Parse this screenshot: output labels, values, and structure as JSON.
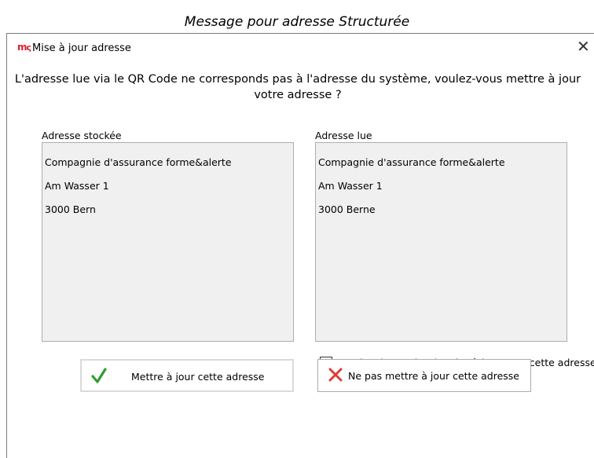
{
  "caption": "Message pour adresse Structurée",
  "dialog": {
    "app_icon": "m",
    "title": "Mise à jour adresse",
    "close_symbol": "✕",
    "message_line1": "L'adresse lue via le QR Code ne corresponds pas à l'adresse du système, voulez-vous mettre à jour",
    "message_line2": "votre adresse ?",
    "stored": {
      "label": "Adresse stockée",
      "lines": [
        "Compagnie d'assurance forme&alerte",
        "Am Wasser 1",
        "3000 Bern"
      ]
    },
    "read": {
      "label": "Adresse lue",
      "lines": [
        "Compagnie d'assurance forme&alerte",
        "Am Wasser 1",
        "3000 Berne"
      ]
    },
    "checkbox": {
      "label": "Ne plus demander de mise à jour pour cette adresse",
      "checked": false
    },
    "buttons": {
      "update_label": "Mettre à jour cette adresse",
      "update_icon": "checkmark-icon",
      "skip_label": "Ne pas mettre à jour cette adresse",
      "skip_icon": "red-x-icon"
    },
    "colors": {
      "brand": "#d8202f",
      "check": "#2e9e2e",
      "cross": "#e03c31"
    }
  }
}
